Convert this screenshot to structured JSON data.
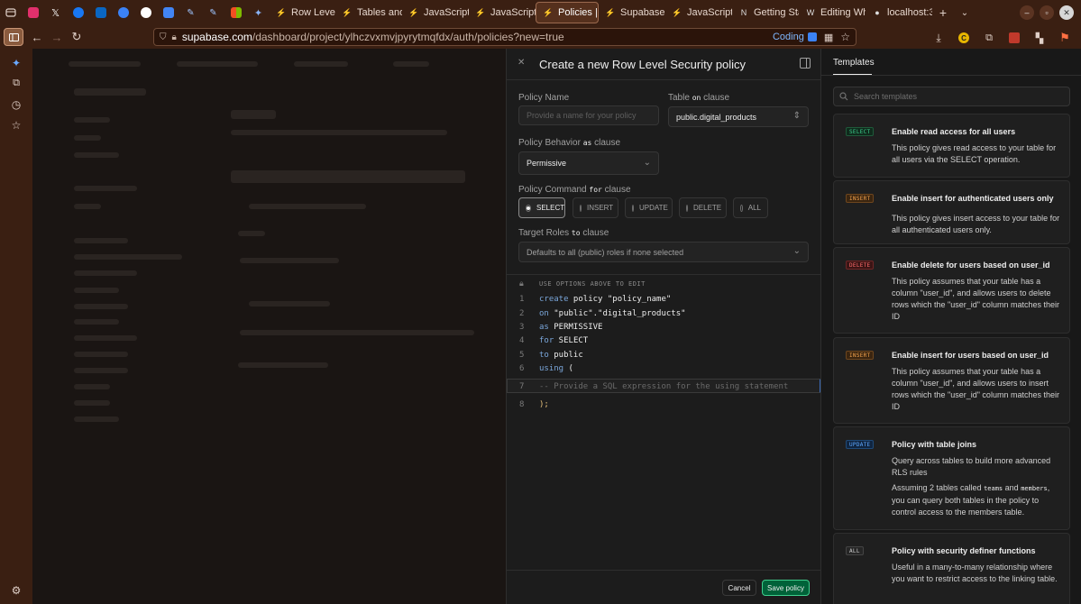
{
  "browser": {
    "tabs": [
      {
        "label": "Row Level"
      },
      {
        "label": "Tables and"
      },
      {
        "label": "JavaScript"
      },
      {
        "label": "JavaScript"
      },
      {
        "label": "Policies |",
        "active": true
      },
      {
        "label": "Supabase D"
      },
      {
        "label": "JavaScript"
      },
      {
        "label": "Getting Sta"
      },
      {
        "label": "Editing Wh"
      },
      {
        "label": "localhost:3"
      }
    ],
    "url_host": "supabase.com",
    "url_path": "/dashboard/project/ylhczvxmvjpyrytmqfdx/auth/policies?new=true",
    "coding_badge": "Coding"
  },
  "panel": {
    "title": "Create a new Row Level Security policy",
    "policy_name_label": "Policy Name",
    "policy_name_placeholder": "Provide a name for your policy",
    "table_label": "Table",
    "table_on": "on",
    "table_clause": "clause",
    "table_value": "public.digital_products",
    "behavior_label": "Policy Behavior",
    "behavior_as": "as",
    "behavior_clause": "clause",
    "behavior_value": "Permissive",
    "command_label": "Policy Command",
    "command_for": "for",
    "command_clause": "clause",
    "commands": [
      "SELECT",
      "INSERT",
      "UPDATE",
      "DELETE",
      "ALL"
    ],
    "selected_command": "SELECT",
    "roles_label": "Target Roles",
    "roles_to": "to",
    "roles_clause": "clause",
    "roles_value": "Defaults to all (public) roles if none selected",
    "editor_hint": "USE OPTIONS ABOVE TO EDIT",
    "code_lines": [
      {
        "n": "1",
        "kw": "create",
        "rest": " policy \"policy_name\""
      },
      {
        "n": "2",
        "kw": "on",
        "rest": " \"public\".\"digital_products\""
      },
      {
        "n": "3",
        "kw": "as",
        "rest": " PERMISSIVE"
      },
      {
        "n": "4",
        "kw": "for",
        "rest": " SELECT"
      },
      {
        "n": "5",
        "kw": "to",
        "rest": " public"
      },
      {
        "n": "6",
        "kw": "using",
        "rest": " ("
      },
      {
        "n": "7",
        "kw": "",
        "rest": "-- Provide a SQL expression for the using statement"
      },
      {
        "n": "8",
        "kw": "",
        "rest": ");"
      }
    ],
    "cancel_label": "Cancel",
    "save_label": "Save policy"
  },
  "templates": {
    "tab_label": "Templates",
    "search_placeholder": "Search templates",
    "cards": [
      {
        "badge": "SELECT",
        "badge_class": "b-select",
        "title": "Enable read access for all users",
        "desc": "This policy gives read access to your table for all users via the SELECT operation."
      },
      {
        "badge": "INSERT",
        "badge_class": "b-insert",
        "title": "Enable insert for authenticated users only",
        "desc": "This policy gives insert access to your table for all authenticated users only."
      },
      {
        "badge": "DELETE",
        "badge_class": "b-delete",
        "title": "Enable delete for users based on user_id",
        "desc": "This policy assumes that your table has a column \"user_id\", and allows users to delete rows which the \"user_id\" column matches their ID"
      },
      {
        "badge": "INSERT",
        "badge_class": "b-insert",
        "title": "Enable insert for users based on user_id",
        "desc": "This policy assumes that your table has a column \"user_id\", and allows users to insert rows which the \"user_id\" column matches their ID"
      },
      {
        "badge": "UPDATE",
        "badge_class": "b-update",
        "title": "Policy with table joins",
        "desc": "Query across tables to build more advanced RLS rules",
        "desc2_a": "Assuming 2 tables called",
        "desc2_code1": "teams",
        "desc2_b": "and",
        "desc2_code2": "members",
        "desc2_c": ", you can query both tables in the policy to control access to the members table."
      },
      {
        "badge": "ALL",
        "badge_class": "b-all",
        "title": "Policy with security definer functions",
        "desc": "Useful in a many-to-many relationship where you want to restrict access to the linking table."
      }
    ]
  }
}
